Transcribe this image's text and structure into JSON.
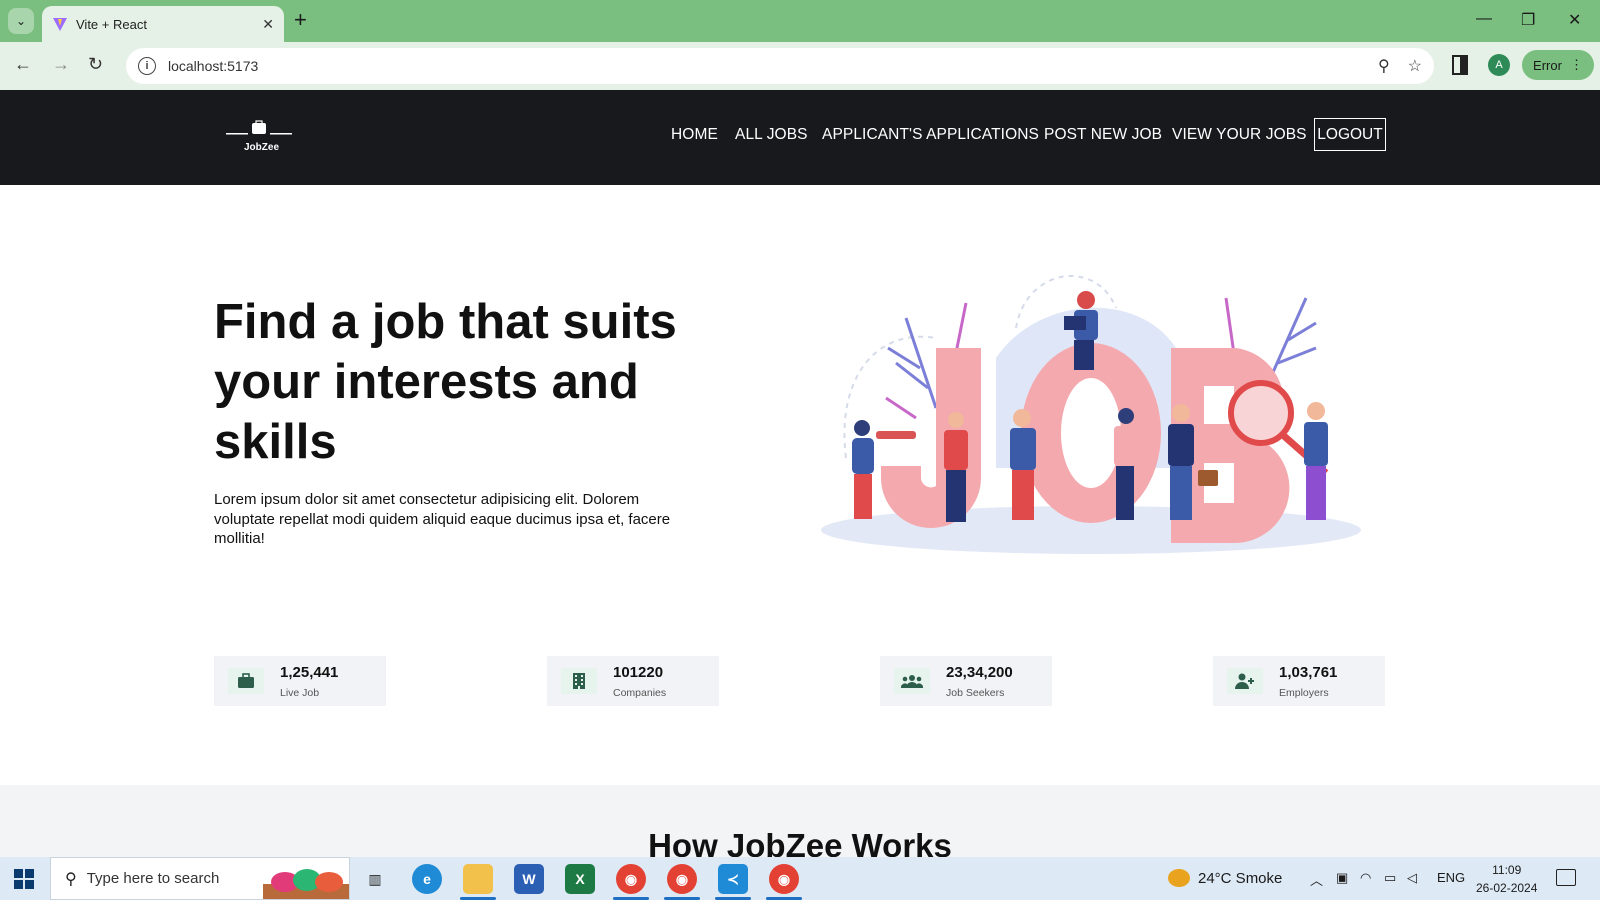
{
  "browser": {
    "tab_title": "Vite + React",
    "url": "localhost:5173",
    "profile_initial": "A",
    "error_label": "Error"
  },
  "site": {
    "logo_text": "JobZee",
    "nav": [
      "HOME",
      "ALL JOBS",
      "APPLICANT'S APPLICATIONS",
      "POST NEW JOB",
      "VIEW YOUR JOBS"
    ],
    "logout": "LOGOUT"
  },
  "hero": {
    "title": "Find a job that suits your interests and skills",
    "text": "Lorem ipsum dolor sit amet consectetur adipisicing elit. Dolorem voluptate repellat modi quidem aliquid eaque ducimus ipsa et, facere mollitia!"
  },
  "stats": [
    {
      "value": "1,25,441",
      "label": "Live Job",
      "icon": "briefcase-icon"
    },
    {
      "value": "101220",
      "label": "Companies",
      "icon": "building-icon"
    },
    {
      "value": "23,34,200",
      "label": "Job Seekers",
      "icon": "users-icon"
    },
    {
      "value": "1,03,761",
      "label": "Employers",
      "icon": "user-plus-icon"
    }
  ],
  "works": {
    "title": "How JobZee Works"
  },
  "taskbar": {
    "search_placeholder": "Type here to search",
    "weather": "24°C  Smoke",
    "language": "ENG",
    "time": "11:09",
    "date": "26-02-2024"
  },
  "colors": {
    "tabbar": "#7abf7f",
    "toolbar": "#e5f1e6",
    "site_nav": "#18191c",
    "stat_icon": "#2d5e4a"
  }
}
